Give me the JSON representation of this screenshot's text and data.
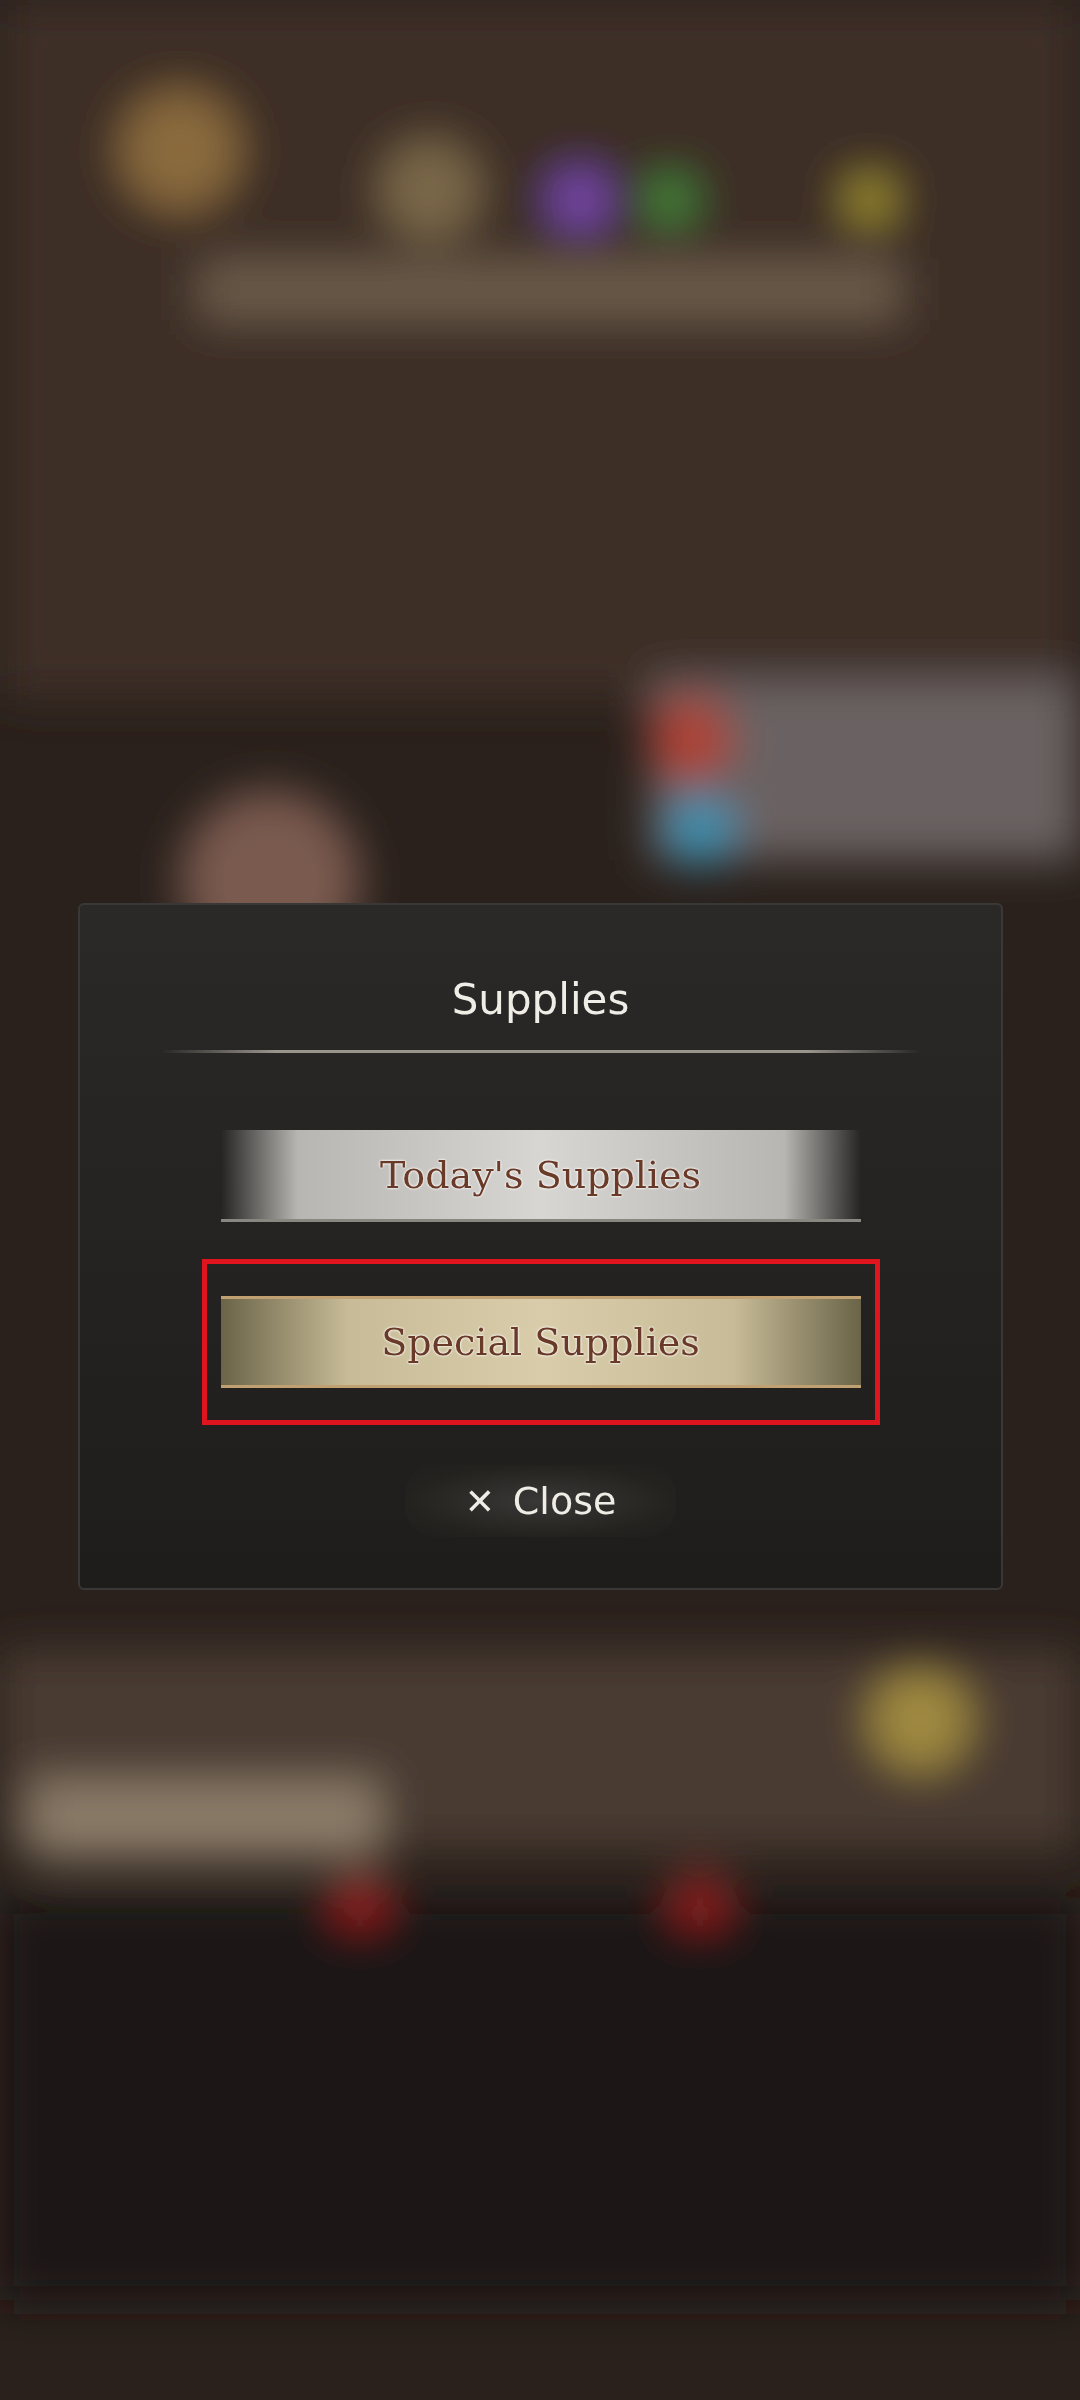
{
  "dialog": {
    "title": "Supplies",
    "options": [
      {
        "label": "Today's Supplies",
        "kind": "silver",
        "highlighted": false
      },
      {
        "label": "Special Supplies",
        "kind": "gold",
        "highlighted": true
      }
    ],
    "close": {
      "icon": "✕",
      "label": "Close"
    }
  }
}
